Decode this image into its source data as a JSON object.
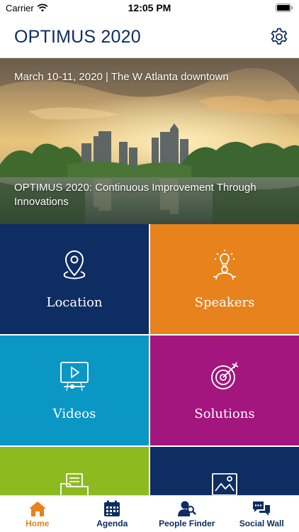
{
  "status_bar": {
    "carrier": "Carrier",
    "time": "12:05 PM"
  },
  "header": {
    "title": "OPTIMUS 2020",
    "settings_icon": "gear-icon"
  },
  "hero": {
    "date_line": "March 10-11, 2020 | The W Atlanta downtown",
    "headline": "OPTIMUS 2020: Continuous Improvement Through Innovations"
  },
  "tiles": [
    {
      "label": "Location",
      "icon": "map-pin-icon",
      "color": "#0e2d62"
    },
    {
      "label": "Speakers",
      "icon": "speaker-idea-icon",
      "color": "#e8821c"
    },
    {
      "label": "Videos",
      "icon": "video-play-icon",
      "color": "#0b97c4"
    },
    {
      "label": "Solutions",
      "icon": "target-icon",
      "color": "#a3167d"
    },
    {
      "label": "",
      "icon": "folder-icon",
      "color": "#8dbb1f"
    },
    {
      "label": "",
      "icon": "gallery-icon",
      "color": "#0e2d62"
    }
  ],
  "tab_bar": {
    "active_color": "#e8821c",
    "inactive_color": "#0e2d62",
    "tabs": [
      {
        "label": "Home",
        "icon": "home-icon",
        "active": true
      },
      {
        "label": "Agenda",
        "icon": "calendar-icon",
        "active": false
      },
      {
        "label": "People Finder",
        "icon": "people-search-icon",
        "active": false
      },
      {
        "label": "Social Wall",
        "icon": "chat-bubbles-icon",
        "active": false
      }
    ]
  }
}
